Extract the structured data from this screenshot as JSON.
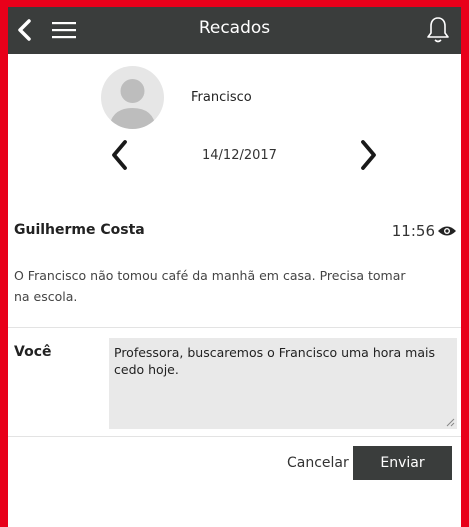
{
  "header": {
    "title": "Recados",
    "back_icon": "chevron-left-icon",
    "menu_icon": "hamburger-menu-icon",
    "notification_icon": "bell-icon"
  },
  "student": {
    "name": "Francisco",
    "avatar_icon": "user-avatar-icon"
  },
  "date_nav": {
    "date": "14/12/2017",
    "prev_icon": "chevron-left-icon",
    "next_icon": "chevron-right-icon"
  },
  "message": {
    "sender": "Guilherme Costa",
    "time": "11:56",
    "read_icon": "eye-icon",
    "text": "O Francisco não tomou café da manhã em casa. Precisa tomar na escola."
  },
  "reply": {
    "label": "Você",
    "value": "Professora, buscaremos o Francisco uma hora mais cedo hoje."
  },
  "actions": {
    "cancel_label": "Cancelar",
    "send_label": "Enviar"
  },
  "colors": {
    "frame": "#e8001a",
    "topbar": "#3a3d3c",
    "input_bg": "#e9e9e9"
  }
}
